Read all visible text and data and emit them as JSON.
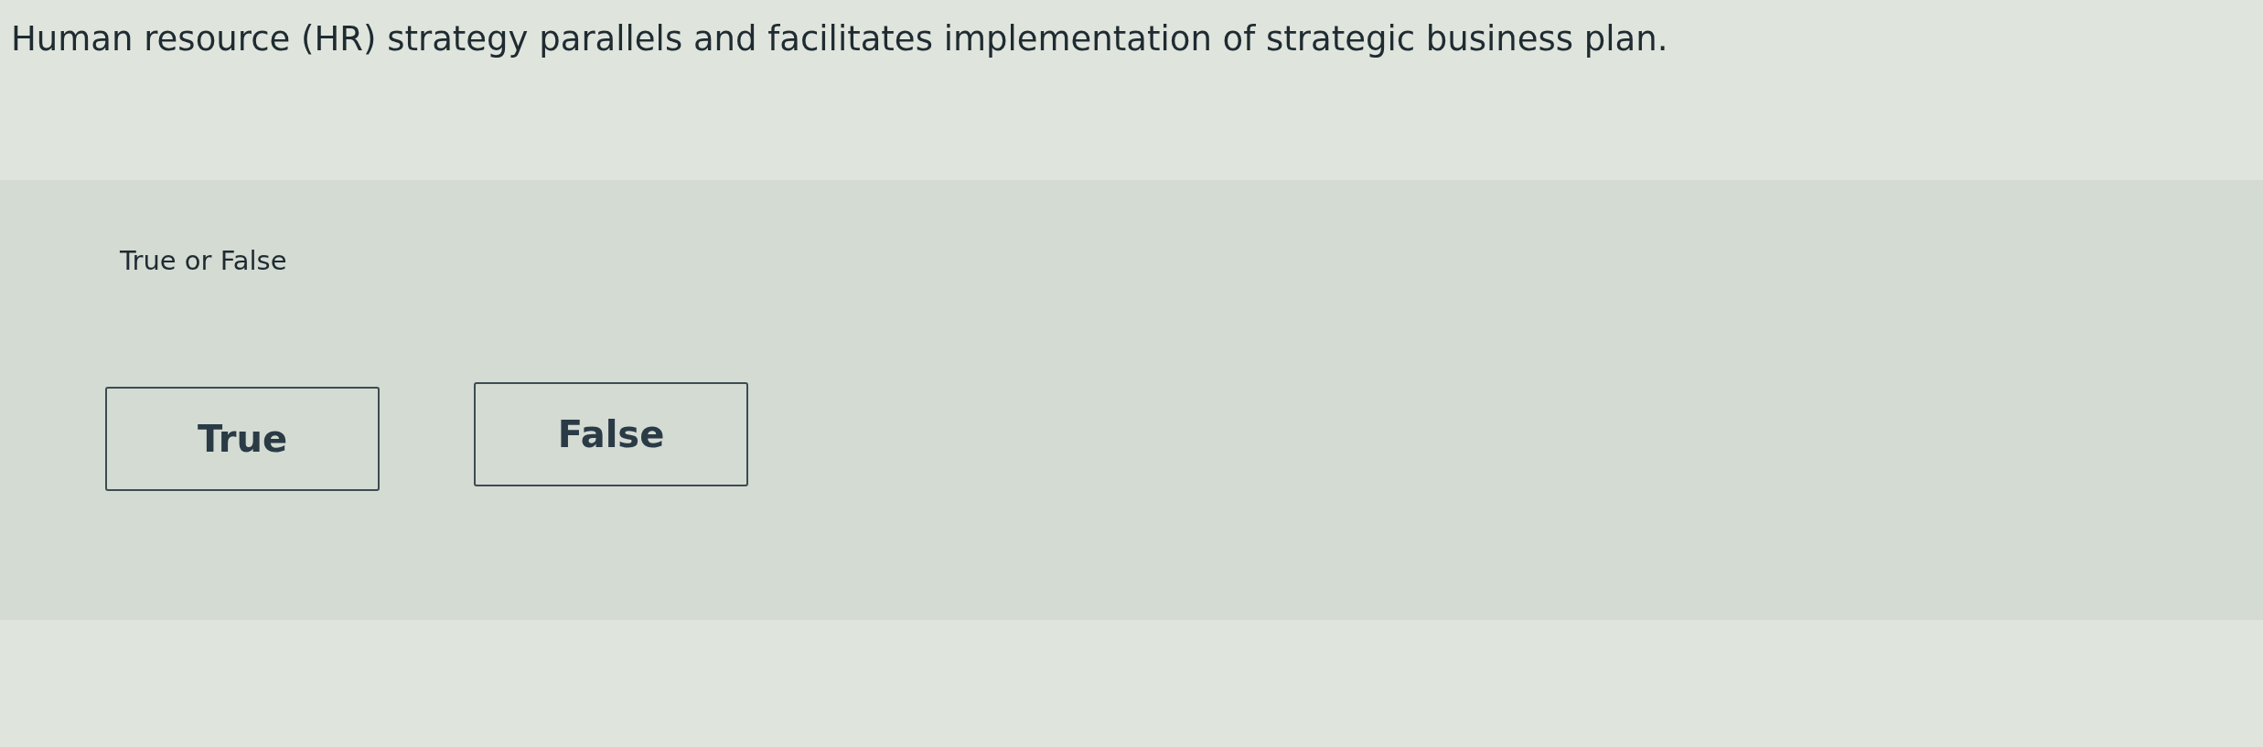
{
  "question": {
    "text": "Human resource (HR) strategy parallels and facilitates implementation of strategic business plan."
  },
  "answer_panel": {
    "prompt": "True or False",
    "options": [
      {
        "label": "True"
      },
      {
        "label": "False"
      }
    ]
  }
}
